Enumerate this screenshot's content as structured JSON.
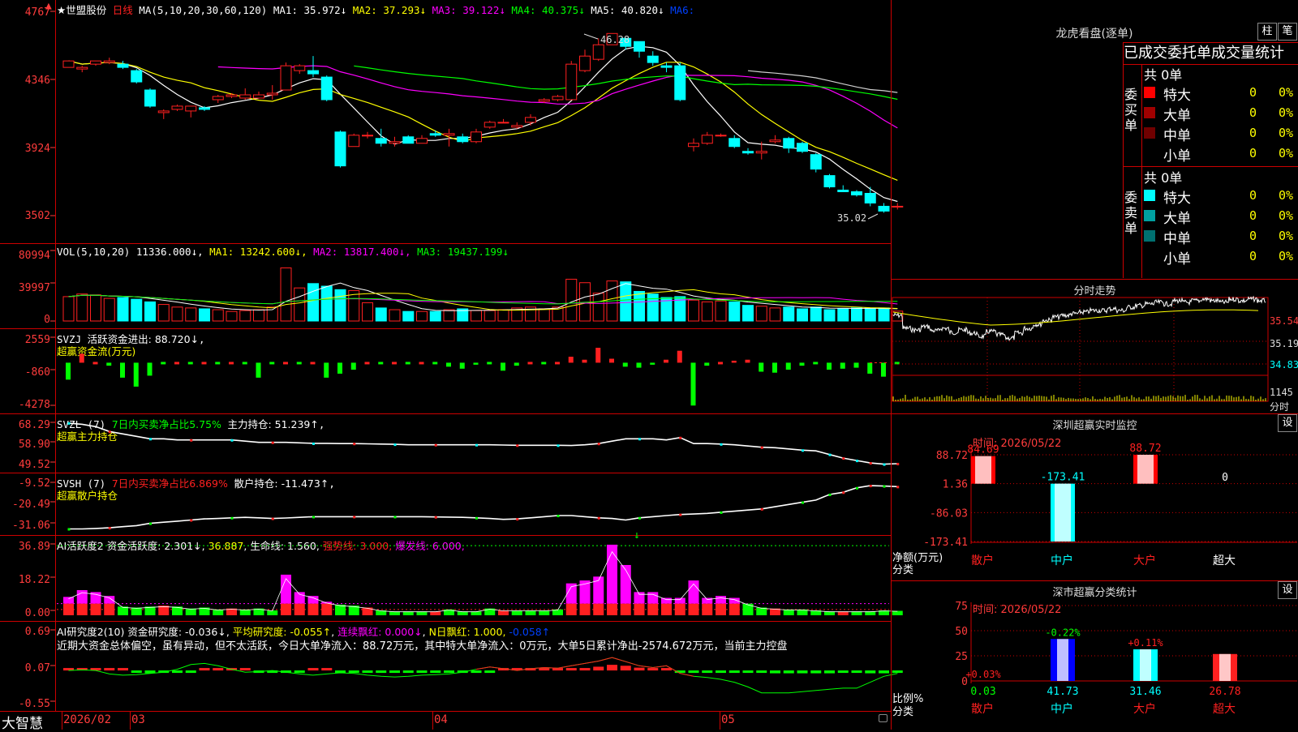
{
  "colors": {
    "up": "#ff2020",
    "down": "#00ffff",
    "ma5": "#ffffff",
    "ma10": "#ffff00",
    "ma20": "#ff00ff",
    "ma30": "#00ff00",
    "ma60": "#cfcfcf"
  },
  "main": {
    "name": "★世盟股份",
    "period": "日线",
    "ma_label": "MA(5,10,20,30,60,120)",
    "ma1": "MA1: 35.972↓",
    "ma2": "MA2: 37.293↓",
    "ma3": "MA3: 39.122↓",
    "ma4": "MA4: 40.375↓",
    "ma5": "MA5: 40.820↓",
    "ma6": "MA6:",
    "yticks": [
      "4767",
      "4346",
      "3924",
      "3502"
    ],
    "high_label": "46.28",
    "low_label": "35.02"
  },
  "vol": {
    "label": "VOL(5,10,20)",
    "value": "11336.000↓",
    "ma1": "MA1: 13242.600↓",
    "ma2": "MA2: 13817.400↓",
    "ma3": "MA3: 19437.199↓",
    "yticks": [
      "80994",
      "39997",
      "0"
    ]
  },
  "svzj": {
    "label": "SVZJ",
    "title": "活跃资金进出: 88.720↓",
    "sub": "超赢资金流(万元)",
    "yticks": [
      "2559",
      "-860",
      "-4278"
    ]
  },
  "svzl": {
    "label": "SVZL (7)",
    "t1": "7日内买卖净占比5.75%",
    "t2": "主力持仓: 51.239↑",
    "sep": ",",
    "sub": "超赢主力持仓",
    "yticks": [
      "68.29",
      "58.90",
      "49.52"
    ]
  },
  "svsh": {
    "label": "SVSH (7)",
    "t1": "7日内买卖净占比6.869%",
    "t2": "散户持仓: -11.473↑",
    "sep": ",",
    "sub": "超赢散户持仓",
    "yticks": [
      "-9.52",
      "-20.49",
      "-31.06"
    ]
  },
  "ai2": {
    "label": "AI活跃度2",
    "t1": "资金活跃度: 2.301↓",
    "t2": "36.887",
    "t3": "生命线: 1.560",
    "t4": "强势线: 3.000",
    "t5": "爆发线: 6.000",
    "yticks": [
      "36.89",
      "18.22",
      "0.00"
    ]
  },
  "ai10": {
    "label": "AI研究度2(10)",
    "t1": "资金研究度: -0.036↓",
    "t2": "平均研究度: -0.055↑",
    "t3": "连续飘红: 0.000↓",
    "t4": "N日飘红: 1.000",
    "t5": "-0.058↑",
    "desc": "近期大资金总体偏空，虽有异动，但不太活跃，今日大单净流入：88.72万元，其中特大单净流入：0万元，大单5日累计净出-2574.672万元，当前主力控盘",
    "yticks": [
      "0.69",
      "0.07",
      "-0.55"
    ]
  },
  "xaxis": {
    "brand": "大智慧",
    "labels": [
      "2026/02",
      "03",
      "04",
      "05"
    ]
  },
  "longhu": {
    "title": "龙虎看盘(逐单)",
    "btn1": "柱",
    "btn2": "笔",
    "header": "已成交委托单成交量统计",
    "buy": {
      "side": "委买单",
      "total": "共 0单",
      "rows": [
        {
          "name": "特大",
          "v": "0",
          "p": "0%",
          "color": "#ff0000"
        },
        {
          "name": "大单",
          "v": "0",
          "p": "0%",
          "color": "#a00000"
        },
        {
          "name": "中单",
          "v": "0",
          "p": "0%",
          "color": "#700000"
        },
        {
          "name": "小单",
          "v": "0",
          "p": "0%",
          "color": "#000000"
        }
      ]
    },
    "sell": {
      "side": "委卖单",
      "total": "共 0单",
      "rows": [
        {
          "name": "特大",
          "v": "0",
          "p": "0%",
          "color": "#00ffff"
        },
        {
          "name": "大单",
          "v": "0",
          "p": "0%",
          "color": "#00a0a0"
        },
        {
          "name": "中单",
          "v": "0",
          "p": "0%",
          "color": "#007070"
        },
        {
          "name": "小单",
          "v": "0",
          "p": "0%",
          "color": "#000000"
        }
      ]
    }
  },
  "fenshi": {
    "title": "分时走势",
    "yticks": [
      "35.54",
      "35.19",
      "34.83"
    ],
    "vol_label": "1145",
    "fenshi_label": "分时"
  },
  "sz_monitor": {
    "title": "深圳超赢实时监控",
    "btn": "设",
    "time": "时间: 2026/05/22",
    "yticks": [
      "88.72",
      "1.36",
      "-86.03",
      "-173.41"
    ],
    "ylabel": "净额(万元)",
    "xlabel": "分类",
    "bars": [
      {
        "cat": "散户",
        "value": 84.69,
        "label": "84.69",
        "lc": "#ff2020"
      },
      {
        "cat": "中户",
        "value": -173.41,
        "label": "-173.41",
        "lc": "#00ffff"
      },
      {
        "cat": "大户",
        "value": 88.72,
        "label": "88.72",
        "lc": "#ff2020"
      },
      {
        "cat": "超大",
        "value": 0,
        "label": "0",
        "lc": "#ffffff"
      }
    ]
  },
  "sz_class": {
    "title": "深市超赢分类统计",
    "btn": "设",
    "time": "时间: 2026/05/22",
    "yticks": [
      "75",
      "50",
      "25",
      "0"
    ],
    "ylabel": "比例%",
    "xlabel": "分类",
    "bars": [
      {
        "cat": "散户",
        "ratio": 0.03,
        "delta": "+0.03%",
        "dc": "#ff2020",
        "label": "0.03"
      },
      {
        "cat": "中户",
        "ratio": 41.73,
        "delta": "-0.22%",
        "dc": "#00ff00",
        "label": "41.73"
      },
      {
        "cat": "大户",
        "ratio": 31.46,
        "delta": "+0.11%",
        "dc": "#ff2020",
        "label": "31.46"
      },
      {
        "cat": "超大",
        "ratio": 26.78,
        "delta": "",
        "dc": "#ff2020",
        "label": "26.78"
      }
    ]
  },
  "chart_data": [
    {
      "type": "candlestick",
      "title": "★世盟股份 日线",
      "y_unit": "price",
      "ylim": [
        35.02,
        47.67
      ],
      "ohlc": [
        [
          44.2,
          44.6,
          44.6,
          44.2
        ],
        [
          44.1,
          44.2,
          43.9,
          44.3
        ],
        [
          44.4,
          44.6,
          44.6,
          44.3
        ],
        [
          44.5,
          44.6,
          44.8,
          44.4
        ],
        [
          44.4,
          44.2,
          44.6,
          44.1
        ],
        [
          44.0,
          43.3,
          44.1,
          43.2
        ],
        [
          42.8,
          41.8,
          42.9,
          41.7
        ],
        [
          41.4,
          41.5,
          41.6,
          41.0
        ],
        [
          41.6,
          41.8,
          41.9,
          41.5
        ],
        [
          41.5,
          41.8,
          41.8,
          41.1
        ],
        [
          41.7,
          41.6,
          41.8,
          41.5
        ],
        [
          42.2,
          42.4,
          42.5,
          42.0
        ],
        [
          42.4,
          42.5,
          42.6,
          42.3
        ],
        [
          42.3,
          42.5,
          42.9,
          42.2
        ],
        [
          42.3,
          42.5,
          42.7,
          42.3
        ],
        [
          42.5,
          42.6,
          43.1,
          42.2
        ],
        [
          42.8,
          44.3,
          44.5,
          42.8
        ],
        [
          44.0,
          44.3,
          44.4,
          43.8
        ],
        [
          44.0,
          43.8,
          44.9,
          43.6
        ],
        [
          43.6,
          42.2,
          43.7,
          42.1
        ],
        [
          40.2,
          38.1,
          40.3,
          38.0
        ],
        [
          39.3,
          40.0,
          40.1,
          39.3
        ],
        [
          40.0,
          40.0,
          40.2,
          39.8
        ],
        [
          39.8,
          39.5,
          40.4,
          39.3
        ],
        [
          39.5,
          39.6,
          39.9,
          39.3
        ],
        [
          39.9,
          39.5,
          40.0,
          39.5
        ],
        [
          39.5,
          39.8,
          40.0,
          39.5
        ],
        [
          40.1,
          40.0,
          40.3,
          39.9
        ],
        [
          40.0,
          40.1,
          40.4,
          39.3
        ],
        [
          39.9,
          39.6,
          40.1,
          39.5
        ],
        [
          39.6,
          40.2,
          40.4,
          39.5
        ],
        [
          40.5,
          40.8,
          40.9,
          40.4
        ],
        [
          40.8,
          40.8,
          41.0,
          40.8
        ],
        [
          40.5,
          40.6,
          40.8,
          40.4
        ],
        [
          40.8,
          41.1,
          41.3,
          40.6
        ],
        [
          42.1,
          42.2,
          42.3,
          42.0
        ],
        [
          42.2,
          42.4,
          42.5,
          42.1
        ],
        [
          42.2,
          44.4,
          44.6,
          42.2
        ],
        [
          44.0,
          44.9,
          45.3,
          43.9
        ],
        [
          44.7,
          45.6,
          46.0,
          44.6
        ],
        [
          45.6,
          46.3,
          46.3,
          45.6
        ],
        [
          46.0,
          45.5,
          46.0,
          45.3
        ],
        [
          45.8,
          45.2,
          45.8,
          44.8
        ],
        [
          44.9,
          44.5,
          45.2,
          44.3
        ],
        [
          44.3,
          44.2,
          44.5,
          43.9
        ],
        [
          44.3,
          42.2,
          44.5,
          42.1
        ],
        [
          39.3,
          39.5,
          39.8,
          39.0
        ],
        [
          39.5,
          40.0,
          40.2,
          39.4
        ],
        [
          40.0,
          40.0,
          40.1,
          39.9
        ],
        [
          39.8,
          39.3,
          40.0,
          39.2
        ],
        [
          39.0,
          38.9,
          39.2,
          38.8
        ],
        [
          38.9,
          39.0,
          39.6,
          38.5
        ],
        [
          39.6,
          39.7,
          40.0,
          39.5
        ],
        [
          39.8,
          39.2,
          39.9,
          38.9
        ],
        [
          39.5,
          39.0,
          39.6,
          38.9
        ],
        [
          38.8,
          37.9,
          38.9,
          37.7
        ],
        [
          37.5,
          36.8,
          37.6,
          36.7
        ],
        [
          36.6,
          36.5,
          36.9,
          36.5
        ],
        [
          36.5,
          36.3,
          36.6,
          36.2
        ],
        [
          36.4,
          35.8,
          36.8,
          35.6
        ],
        [
          35.6,
          35.3,
          35.8,
          35.2
        ],
        [
          35.6,
          35.6,
          35.8,
          35.4
        ]
      ],
      "ma": {
        "MA1": 35.972,
        "MA2": 37.293,
        "MA3": 39.122,
        "MA4": 40.375,
        "MA5": 40.82
      },
      "high": 46.28,
      "low": 35.02
    },
    {
      "type": "bar",
      "title": "VOL(5,10,20)",
      "ylim": [
        0,
        80994
      ],
      "values": [
        28000,
        31000,
        30000,
        26000,
        27000,
        25000,
        22000,
        19000,
        16000,
        15000,
        14000,
        13000,
        11000,
        12000,
        13000,
        16000,
        61000,
        38000,
        43000,
        40000,
        36000,
        35000,
        21000,
        15000,
        13000,
        11000,
        11000,
        11000,
        13000,
        14000,
        12000,
        12000,
        13000,
        15000,
        16000,
        14000,
        16000,
        48000,
        44000,
        32000,
        46000,
        45000,
        34000,
        31000,
        27000,
        28000,
        24000,
        22000,
        23000,
        22000,
        18000,
        17000,
        15000,
        16000,
        14000,
        16000,
        13000,
        14000,
        15000,
        15000,
        15000,
        11336
      ]
    },
    {
      "type": "bar",
      "title": "SVZJ 超赢资金流(万元)",
      "ylim": [
        -4278,
        2559
      ],
      "values": [
        -1700,
        900,
        0,
        -300,
        -1500,
        -2400,
        -1300,
        0,
        0,
        0,
        0,
        0,
        0,
        0,
        -1500,
        0,
        0,
        0,
        0,
        -1500,
        -1100,
        -700,
        0,
        0,
        0,
        0,
        0,
        0,
        -400,
        -600,
        -200,
        0,
        -800,
        -300,
        0,
        0,
        0,
        600,
        300,
        1500,
        400,
        -400,
        -500,
        -200,
        300,
        1200,
        -4300,
        -300,
        0,
        200,
        300,
        -900,
        -1000,
        -700,
        -300,
        0,
        -700,
        -600,
        -500,
        -1100,
        -1400,
        0,
        -1200,
        0,
        88.72
      ]
    },
    {
      "type": "line",
      "title": "SVZL 超赢主力持仓",
      "ylim": [
        49.52,
        68.29
      ],
      "series": [
        {
          "name": "主力持仓",
          "values": [
            68.0,
            67.5,
            66.5,
            64.5,
            63.5,
            62.5,
            61.5,
            61.5,
            61.0,
            61.0,
            61.0,
            61.0,
            61.0,
            60.5,
            60.0,
            60.0,
            60.0,
            59.8,
            59.6,
            59.6,
            59.5,
            59.5,
            59.4,
            59.3,
            59.2,
            59.0,
            59.0,
            59.0,
            59.0,
            59.0,
            59.0,
            59.0,
            58.9,
            58.8,
            58.8,
            58.8,
            58.8,
            58.7,
            59.0,
            59.5,
            60.5,
            61.5,
            61.5,
            61.5,
            61.0,
            62.0,
            59.5,
            59.5,
            59.3,
            59.0,
            58.5,
            58.0,
            57.8,
            57.3,
            56.8,
            56.5,
            55.0,
            53.5,
            52.5,
            51.5,
            51.0,
            51.2
          ]
        }
      ]
    },
    {
      "type": "line",
      "title": "SVSH 超赢散户持仓",
      "ylim": [
        -31.06,
        -9.52
      ],
      "series": [
        {
          "name": "散户持仓",
          "values": [
            -30.5,
            -30.5,
            -30.3,
            -30.0,
            -29.5,
            -29.0,
            -28.0,
            -27.5,
            -27.0,
            -26.5,
            -26.0,
            -25.8,
            -25.5,
            -25.3,
            -25.5,
            -25.8,
            -25.6,
            -25.3,
            -25.0,
            -25.0,
            -25.0,
            -25.0,
            -25.0,
            -25.0,
            -25.0,
            -25.0,
            -25.0,
            -25.1,
            -25.2,
            -25.3,
            -25.5,
            -25.8,
            -26.2,
            -26.0,
            -25.5,
            -25.0,
            -24.5,
            -24.5,
            -25.0,
            -25.5,
            -25.8,
            -26.5,
            -25.5,
            -25.0,
            -24.5,
            -24.0,
            -23.8,
            -23.5,
            -23.0,
            -22.5,
            -22.0,
            -21.5,
            -20.5,
            -19.5,
            -18.5,
            -17.5,
            -15.0,
            -14.0,
            -12.0,
            -11.0,
            -11.2,
            -11.473
          ]
        }
      ]
    },
    {
      "type": "bar",
      "title": "AI活跃度2 资金活跃度",
      "ylim": [
        0,
        36.89
      ],
      "values": [
        9.5,
        13.0,
        12.0,
        10.0,
        4.5,
        4.0,
        4.5,
        5.0,
        4.5,
        3.5,
        4.0,
        3.0,
        3.5,
        3.0,
        3.5,
        2.5,
        21.0,
        12.0,
        10.0,
        7.0,
        5.5,
        5.0,
        4.0,
        2.5,
        2.0,
        2.0,
        2.0,
        2.0,
        3.0,
        2.0,
        2.0,
        3.5,
        2.5,
        2.5,
        2.5,
        2.5,
        3.0,
        16.5,
        18.0,
        20.0,
        36.5,
        26.0,
        12.0,
        12.0,
        9.0,
        9.0,
        18.0,
        9.0,
        10.0,
        9.0,
        6.0,
        4.0,
        3.5,
        3.0,
        3.0,
        2.5,
        2.0,
        2.0,
        2.0,
        2.0,
        2.5,
        2.3
      ]
    },
    {
      "type": "bar",
      "title": "AI研究度2(10)",
      "ylim": [
        -0.55,
        0.69
      ],
      "values": [
        0.03,
        0.04,
        0.04,
        0.0,
        0.0,
        -0.05,
        -0.06,
        -0.05,
        -0.04,
        -0.03,
        0.02,
        0.03,
        0.02,
        0.0,
        -0.03,
        -0.04,
        -0.03,
        -0.02,
        0.0,
        0.0,
        -0.02,
        -0.03,
        -0.04,
        -0.05,
        -0.05,
        -0.05,
        -0.05,
        -0.05,
        -0.05,
        -0.05,
        -0.04,
        -0.02,
        0.0,
        0.02,
        0.03,
        0.02,
        0.02,
        0.03,
        0.05,
        0.08,
        0.12,
        0.1,
        0.06,
        0.04,
        0.03,
        -0.05,
        -0.05,
        -0.05,
        -0.04,
        -0.05,
        -0.05,
        -0.05,
        -0.06,
        -0.06,
        -0.06,
        -0.06,
        -0.06,
        -0.05,
        -0.05,
        -0.06,
        -0.06,
        -0.036
      ]
    },
    {
      "type": "bar",
      "title": "深圳超赢实时监控",
      "y_unit": "万元",
      "categories": [
        "散户",
        "中户",
        "大户",
        "超大"
      ],
      "values": [
        84.69,
        -173.41,
        88.72,
        0
      ]
    },
    {
      "type": "bar",
      "title": "深市超赢分类统计",
      "y_unit": "比例%",
      "categories": [
        "散户",
        "中户",
        "大户",
        "超大"
      ],
      "values": [
        0.03,
        41.73,
        31.46,
        26.78
      ]
    }
  ]
}
